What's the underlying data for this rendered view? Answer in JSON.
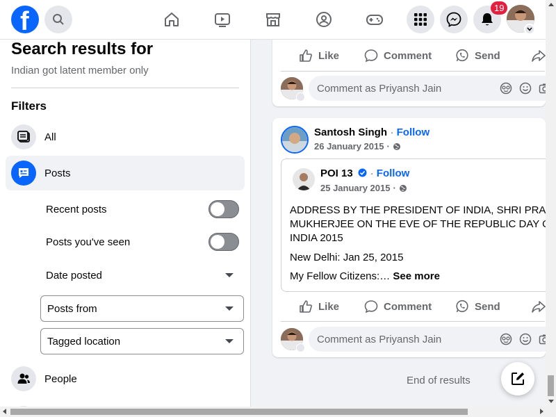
{
  "topbar": {
    "logo_letter": "f",
    "notification_count": "19",
    "nav_icons": [
      "home-icon",
      "video-icon",
      "marketplace-icon",
      "groups-icon",
      "gaming-icon"
    ],
    "right_icons": [
      "menu-grid-icon",
      "messenger-icon",
      "bell-icon"
    ]
  },
  "sidebar": {
    "title": "Search results for",
    "query": "Indian got latent member only",
    "filters_title": "Filters",
    "items": [
      {
        "label": "All",
        "icon": "feed-icon"
      },
      {
        "label": "Posts",
        "icon": "posts-icon",
        "active": true
      },
      {
        "label": "People",
        "icon": "people-icon"
      }
    ],
    "sub_filters": {
      "recent_posts": "Recent posts",
      "posts_seen": "Posts you've seen",
      "date_posted": "Date posted",
      "posts_from": "Posts from",
      "tagged_location": "Tagged location"
    }
  },
  "actions": {
    "like": "Like",
    "comment": "Comment",
    "send": "Send"
  },
  "comment_placeholder": "Comment as Priyansh Jain",
  "post": {
    "author": "Santosh Singh",
    "follow": "Follow",
    "date": "26 January 2015",
    "shared": {
      "author": "POI 13",
      "follow": "Follow",
      "date": "25 January 2015",
      "line1": "ADDRESS BY THE PRESIDENT OF INDIA, SHRI PRA",
      "line2": "MUKHERJEE ON THE EVE OF THE REPUBLIC DAY O",
      "line3": "INDIA 2015",
      "line4": "New Delhi: Jan 25, 2015",
      "line5": "My Fellow Citizens:…",
      "see_more": "See more"
    }
  },
  "end_of_results": "End of results",
  "colors": {
    "brand": "#0866ff",
    "badge": "#e41e3f",
    "muted": "#65676b"
  }
}
